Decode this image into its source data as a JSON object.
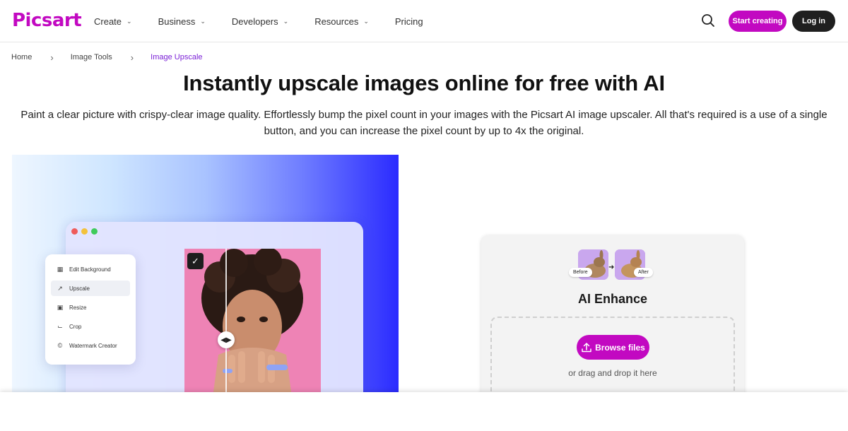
{
  "brand": {
    "logo_text": "Picsart",
    "accent": "#c209c1"
  },
  "nav": {
    "items": [
      {
        "label": "Create",
        "has_dropdown": true
      },
      {
        "label": "Business",
        "has_dropdown": true
      },
      {
        "label": "Developers",
        "has_dropdown": true
      },
      {
        "label": "Resources",
        "has_dropdown": true
      },
      {
        "label": "Pricing",
        "has_dropdown": false
      }
    ],
    "search_icon": "search-icon",
    "start_label": "Start creating",
    "login_label": "Log in"
  },
  "breadcrumb": {
    "items": [
      "Home",
      "Image Tools",
      "Image Upscale"
    ],
    "current_color": "#7a1fd6"
  },
  "hero": {
    "title": "Instantly upscale images online for free with AI",
    "description": "Paint a clear picture with crispy-clear image quality. Effortlessly bump the pixel count in your images with the Picsart AI image upscaler. All that's required is a use of a single button, and you can increase the pixel count by up to 4x the original."
  },
  "preview": {
    "tools": [
      {
        "icon": "grid-icon",
        "label": "Edit Background"
      },
      {
        "icon": "upscale-icon",
        "label": "Upscale",
        "active": true
      },
      {
        "icon": "resize-icon",
        "label": "Resize"
      },
      {
        "icon": "crop-icon",
        "label": "Crop"
      },
      {
        "icon": "copyright-icon",
        "label": "Watermark Creator"
      }
    ]
  },
  "uploader": {
    "before_label": "Before",
    "after_label": "After",
    "title": "AI Enhance",
    "browse_label": "Browse files",
    "drop_hint": "or drag and drop it here"
  }
}
